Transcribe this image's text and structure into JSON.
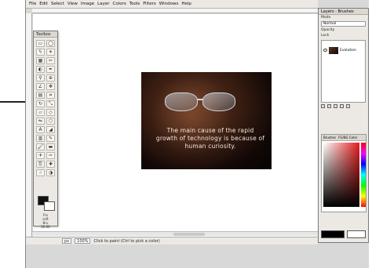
{
  "menu": [
    "File",
    "Edit",
    "Select",
    "View",
    "Image",
    "Layer",
    "Colors",
    "Tools",
    "Filters",
    "Windows",
    "Help"
  ],
  "toolbox": {
    "title": "Toolbox",
    "bottom_text": "Fro\nsoft\nBru\n20.00"
  },
  "image": {
    "caption": "The main cause of the rapid growth of technology is because of human curiosity."
  },
  "statusbar": {
    "unit": "px",
    "zoom": "100%",
    "message": "Click to paint (Ctrl to pick a color)"
  },
  "layers": {
    "title": "Layers - Brushes",
    "mode_label": "Mode",
    "mode_value": "Normal",
    "opacity_label": "Opacity",
    "lock_label": "Lock",
    "layer_name": "Evolution"
  },
  "palette": {
    "tab1": "Brushes",
    "tab2": "FG/BG Color"
  },
  "colors": {
    "foreground": "#000000",
    "background": "#ffffff"
  }
}
